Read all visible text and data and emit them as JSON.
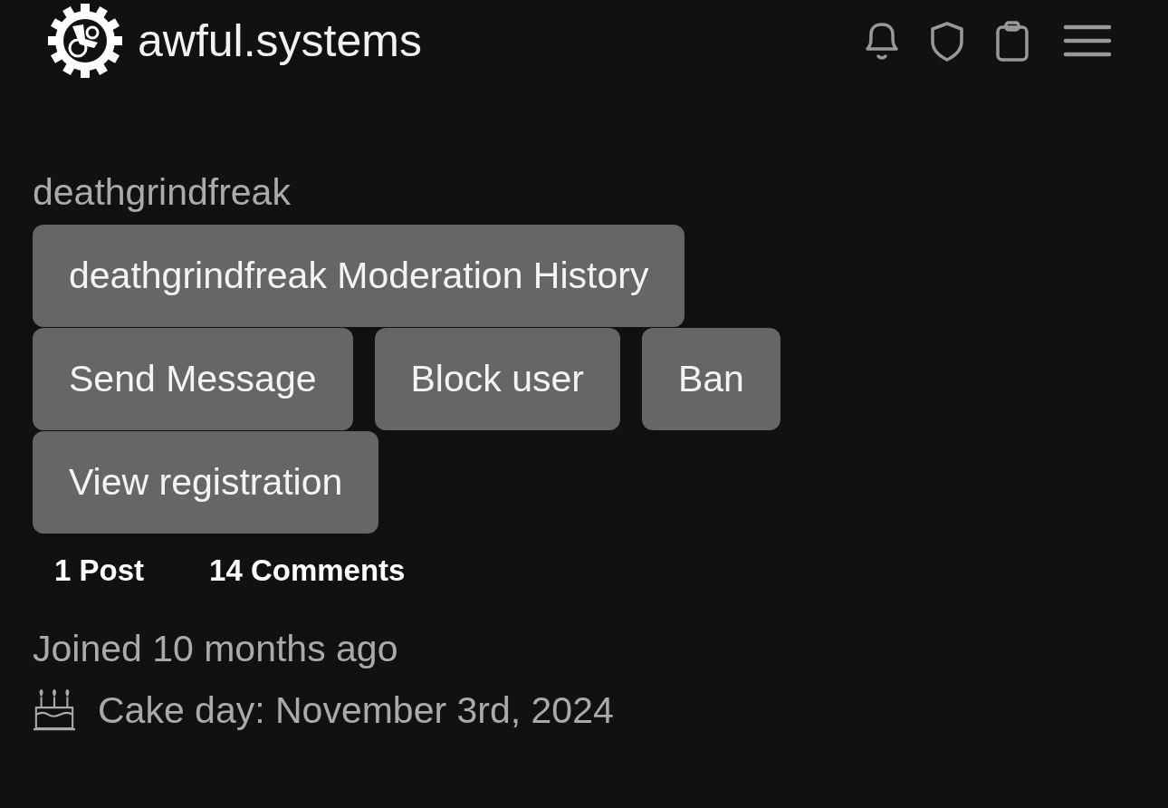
{
  "header": {
    "site_name": "awful.systems"
  },
  "profile": {
    "username": "deathgrindfreak",
    "button_rows": [
      [
        "deathgrindfreak Moderation History"
      ],
      [
        "Send Message",
        "Block user",
        "Ban"
      ],
      [
        "View registration"
      ]
    ],
    "stats": [
      "1 Post",
      "14 Comments"
    ],
    "joined": "Joined 10 months ago",
    "cake_day": "Cake day: November 3rd, 2024"
  }
}
